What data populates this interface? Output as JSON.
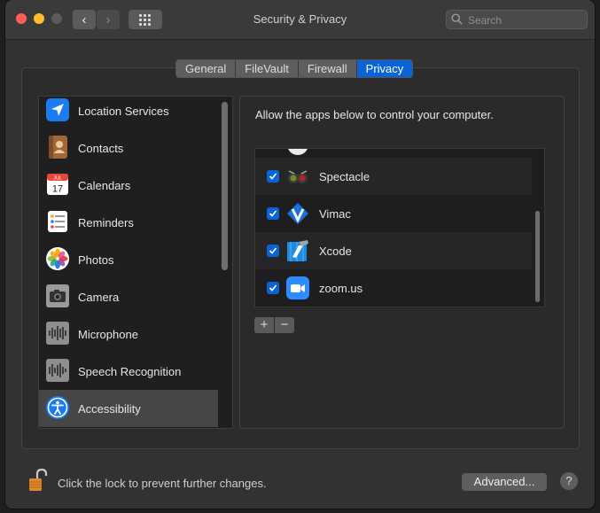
{
  "window": {
    "title": "Security & Privacy"
  },
  "nav": {
    "back": "‹",
    "forward": "›"
  },
  "search": {
    "placeholder": "Search"
  },
  "tabs": [
    {
      "label": "General"
    },
    {
      "label": "FileVault"
    },
    {
      "label": "Firewall"
    },
    {
      "label": "Privacy",
      "active": true
    }
  ],
  "sidebar": {
    "selected": "Accessibility",
    "items": [
      {
        "label": "Location Services",
        "icon": "location-arrow-icon"
      },
      {
        "label": "Contacts",
        "icon": "contacts-book-icon"
      },
      {
        "label": "Calendars",
        "icon": "calendar-icon"
      },
      {
        "label": "Reminders",
        "icon": "reminders-list-icon"
      },
      {
        "label": "Photos",
        "icon": "photos-flower-icon"
      },
      {
        "label": "Camera",
        "icon": "camera-icon"
      },
      {
        "label": "Microphone",
        "icon": "waveform-icon"
      },
      {
        "label": "Speech Recognition",
        "icon": "waveform-icon"
      },
      {
        "label": "Accessibility",
        "icon": "accessibility-icon"
      }
    ],
    "calendar_month": "JUL",
    "calendar_day": "17"
  },
  "panel": {
    "description": "Allow the apps below to control your computer.",
    "apps": [
      {
        "name": "Spectacle",
        "checked": true,
        "icon": "spectacle-icon"
      },
      {
        "name": "Vimac",
        "checked": true,
        "icon": "vimac-icon"
      },
      {
        "name": "Xcode",
        "checked": true,
        "icon": "xcode-hammer-icon"
      },
      {
        "name": "zoom.us",
        "checked": true,
        "icon": "zoom-camera-icon"
      }
    ],
    "add_label": "+",
    "remove_label": "−"
  },
  "footer": {
    "lock_text": "Click the lock to prevent further changes.",
    "advanced_label": "Advanced...",
    "help_label": "?"
  },
  "colors": {
    "accent": "#0a64d6",
    "window_bg": "#323232",
    "close": "#ff5f57",
    "minimize": "#febc2e"
  }
}
